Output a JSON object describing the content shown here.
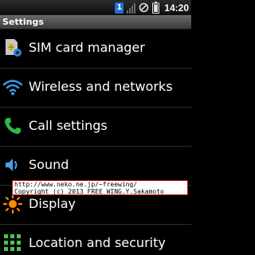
{
  "status_bar": {
    "sim_number": "1",
    "time": "14:20",
    "icons": [
      "sim-1-icon",
      "signal-icon",
      "no-signal-icon",
      "battery-icon"
    ]
  },
  "header": {
    "title": "Settings"
  },
  "settings_items": [
    {
      "label": "SIM card manager",
      "icon": "sim-card-gear-icon"
    },
    {
      "label": "Wireless and networks",
      "icon": "wifi-icon"
    },
    {
      "label": "Call settings",
      "icon": "phone-icon"
    },
    {
      "label": "Sound",
      "icon": "speaker-icon"
    },
    {
      "label": "Display",
      "icon": "brightness-icon"
    },
    {
      "label": "Location and security",
      "icon": "grid-lock-icon"
    }
  ],
  "watermark": {
    "line1": "http://www.neko.ne.jp/~freewing/",
    "line2": "Copyright (c) 2013 FREE WING.Y.Sakamoto"
  },
  "colors": {
    "wifi": "#3a9be8",
    "phone": "#2fb84a",
    "sound": "#4a9fe6",
    "display": "#ff8a00",
    "location": "#4ec24e",
    "sim_badge": "#1f6fd6"
  }
}
